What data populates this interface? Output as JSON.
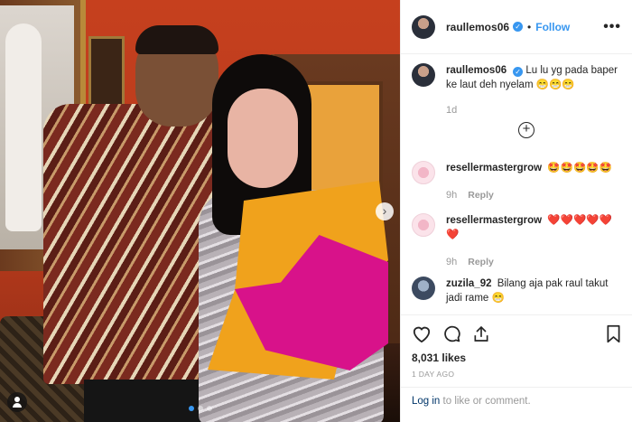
{
  "post": {
    "username": "raullemos06",
    "follow_label": "Follow",
    "more_label": "•••",
    "dot": "•"
  },
  "comments": [
    {
      "username": "raullemos06",
      "verified": true,
      "text": "Lu lu yg pada baper ke laut deh nyelam 😁😁😁",
      "time": "1d",
      "reply": ""
    },
    {
      "username": "resellermastergrow",
      "text": "🤩🤩🤩🤩🤩",
      "time": "9h",
      "reply": "Reply"
    },
    {
      "username": "resellermastergrow",
      "text": "❤️❤️❤️❤️❤️❤️",
      "time": "9h",
      "reply": "Reply"
    },
    {
      "username": "zuzila_92",
      "text": "Bilang aja pak raul takut jadi rame 😁",
      "time": "",
      "reply": ""
    }
  ],
  "load_more_icon": "plus-circle-icon",
  "photo": {
    "carousel_dots": 3,
    "active_dot": 1,
    "next_label": "›"
  },
  "likes": "8,031 likes",
  "posted": "1 DAY AGO",
  "login": {
    "link": "Log in",
    "rest": " to like or comment."
  }
}
